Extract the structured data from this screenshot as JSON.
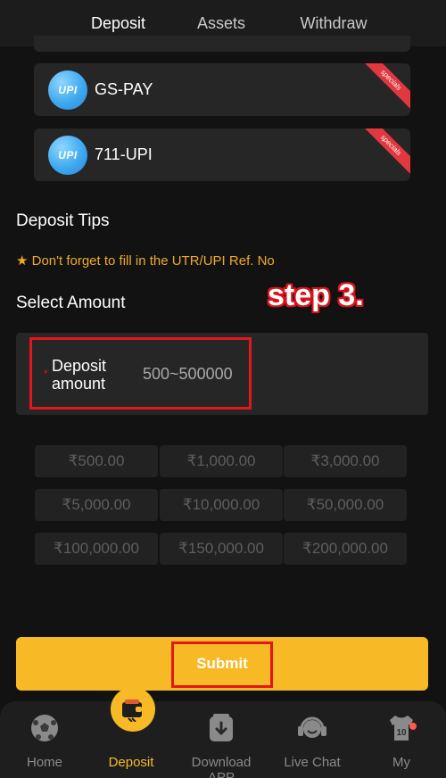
{
  "tabs": [
    {
      "label": "Deposit",
      "active": true
    },
    {
      "label": "Assets",
      "active": false
    },
    {
      "label": "Withdraw",
      "active": false
    }
  ],
  "channels": [
    {
      "logo_text": "UPI",
      "name": "GS-PAY",
      "ribbon": "specials"
    },
    {
      "logo_text": "UPI",
      "name": "711-UPI",
      "ribbon": "specials"
    }
  ],
  "tips": {
    "title": "Deposit Tips",
    "text": "★ Don't forget to fill in the UTR/UPI Ref. No"
  },
  "select_amount": {
    "title": "Select Amount",
    "annotation": "step 3.",
    "required_mark": "*",
    "label": "Deposit amount",
    "placeholder": "500~500000"
  },
  "presets": [
    "₹500.00",
    "₹1,000.00",
    "₹3,000.00",
    "₹5,000.00",
    "₹10,000.00",
    "₹50,000.00",
    "₹100,000.00",
    "₹150,000.00",
    "₹200,000.00"
  ],
  "submit_label": "Submit",
  "bottom_nav": [
    {
      "label": "Home",
      "icon": "soccer-ball-icon",
      "active": false
    },
    {
      "label": "Deposit",
      "icon": "wallet-icon",
      "active": true
    },
    {
      "label": "Download APP",
      "icon": "download-icon",
      "active": false
    },
    {
      "label": "Live Chat",
      "icon": "headset-icon",
      "active": false
    },
    {
      "label": "My",
      "icon": "jersey-icon",
      "jersey_number": "10",
      "active": false
    }
  ],
  "colors": {
    "accent": "#f7b926",
    "tip": "#f0a928",
    "highlight": "#e5151d",
    "ribbon": "#e0383e"
  }
}
